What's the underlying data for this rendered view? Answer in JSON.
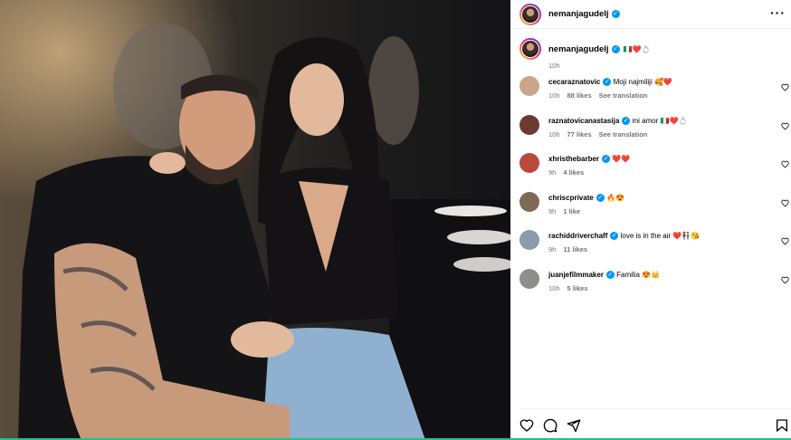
{
  "post": {
    "author": "nemanjagudelj",
    "caption_emojis": "🇮🇹❤️💍",
    "time": "10h"
  },
  "comments": [
    {
      "user": "cecaraznatovic",
      "text": "Moji najmiliji",
      "emoji": "🥰❤️",
      "time": "10h",
      "likes": "88 likes",
      "translate": "See translation",
      "avatar_color": "#c9a58a"
    },
    {
      "user": "raznatovicanastasija",
      "text": "mi amor",
      "emoji": "🇮🇹❤️💍",
      "time": "10h",
      "likes": "77 likes",
      "translate": "See translation",
      "avatar_color": "#6b3a33"
    },
    {
      "user": "xhristhebarber",
      "text": "",
      "emoji": "❤️❤️",
      "time": "9h",
      "likes": "4 likes",
      "translate": "",
      "avatar_color": "#b8493c"
    },
    {
      "user": "chriscprivate",
      "text": "",
      "emoji": "🔥😍",
      "time": "9h",
      "likes": "1 like",
      "translate": "",
      "avatar_color": "#7d6a55"
    },
    {
      "user": "rachiddriverchaff",
      "text": "love is in the air",
      "emoji": "❤️👫😘",
      "time": "9h",
      "likes": "11 likes",
      "translate": "",
      "avatar_color": "#8a9bab"
    },
    {
      "user": "juanjefilmmaker",
      "text": "Familia",
      "emoji": "😍👑",
      "time": "10h",
      "likes": "5 likes",
      "translate": "",
      "avatar_color": "#8c8f8a"
    }
  ],
  "icons": [
    "more-options-icon",
    "heart-icon",
    "comment-icon",
    "share-icon",
    "bookmark-icon",
    "verified-icon"
  ]
}
